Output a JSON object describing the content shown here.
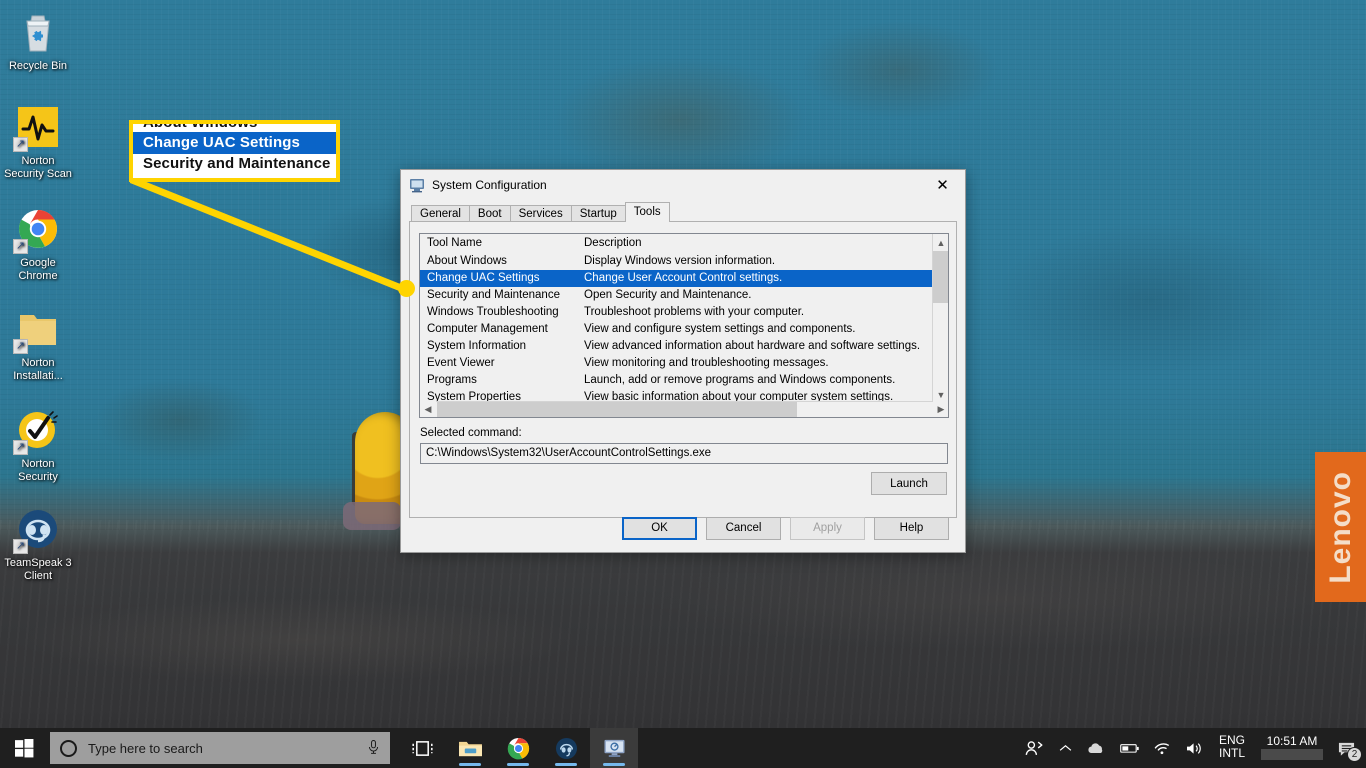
{
  "desktop": {
    "icons": [
      {
        "label": "Recycle Bin",
        "icon": "recycle-bin-icon",
        "shortcut": false
      },
      {
        "label": "Norton\nSecurity Scan",
        "label_l1": "Norton",
        "label_l2": "Security Scan",
        "icon": "norton-security-scan-icon",
        "shortcut": true
      },
      {
        "label": "Google Chrome",
        "label_l1": "Google",
        "label_l2": "Chrome",
        "icon": "google-chrome-icon",
        "shortcut": true
      },
      {
        "label": "Norton Installati...",
        "label_l1": "Norton",
        "label_l2": "Installati...",
        "icon": "folder-icon",
        "shortcut": true
      },
      {
        "label": "Norton Security",
        "label_l1": "Norton",
        "label_l2": "Security",
        "icon": "norton-security-icon",
        "shortcut": true
      },
      {
        "label": "TeamSpeak 3 Client",
        "label_l1": "TeamSpeak 3",
        "label_l2": "Client",
        "icon": "teamspeak-icon",
        "shortcut": true
      }
    ],
    "lenovo_sticker": "Lenovo",
    "colors": {
      "wall": "#2e7a99",
      "floor": "#37383a",
      "sticker": "#e2691c"
    }
  },
  "callout": {
    "rows": [
      {
        "text": "About Windows",
        "selected": false,
        "clipped": "top"
      },
      {
        "text": "Change UAC Settings",
        "selected": true,
        "clipped": "none"
      },
      {
        "text": "Security and Maintenance",
        "selected": false,
        "clipped": "bottom"
      }
    ],
    "border_color": "#ffd400",
    "highlight_color": "#0a64c8"
  },
  "window": {
    "title": "System Configuration",
    "title_icon": "system-configuration-icon",
    "close_label": "✕",
    "tabs": [
      {
        "label": "General",
        "active": false
      },
      {
        "label": "Boot",
        "active": false
      },
      {
        "label": "Services",
        "active": false
      },
      {
        "label": "Startup",
        "active": false
      },
      {
        "label": "Tools",
        "active": true
      }
    ],
    "list": {
      "columns": [
        "Tool Name",
        "Description"
      ],
      "rows": [
        {
          "name": "About Windows",
          "desc": "Display Windows version information.",
          "selected": false
        },
        {
          "name": "Change UAC Settings",
          "desc": "Change User Account Control settings.",
          "selected": true
        },
        {
          "name": "Security and Maintenance",
          "desc": "Open Security and Maintenance.",
          "selected": false
        },
        {
          "name": "Windows Troubleshooting",
          "desc": "Troubleshoot problems with your computer.",
          "selected": false
        },
        {
          "name": "Computer Management",
          "desc": "View and configure system settings and components.",
          "selected": false
        },
        {
          "name": "System Information",
          "desc": "View advanced information about hardware and software settings.",
          "selected": false
        },
        {
          "name": "Event Viewer",
          "desc": "View monitoring and troubleshooting messages.",
          "selected": false
        },
        {
          "name": "Programs",
          "desc": "Launch, add or remove programs and Windows components.",
          "selected": false
        },
        {
          "name": "System Properties",
          "desc": "View basic information about your computer system settings.",
          "selected": false
        }
      ]
    },
    "selected_command_label": "Selected command:",
    "selected_command_value": "C:\\Windows\\System32\\UserAccountControlSettings.exe",
    "launch_label": "Launch",
    "footer_buttons": [
      {
        "label": "OK",
        "state": "default"
      },
      {
        "label": "Cancel",
        "state": "normal"
      },
      {
        "label": "Apply",
        "state": "disabled"
      },
      {
        "label": "Help",
        "state": "normal"
      }
    ]
  },
  "taskbar": {
    "start_icon": "windows-start-icon",
    "search_placeholder": "Type here to search",
    "search_icon": "search-circle-icon",
    "mic_icon": "microphone-icon",
    "buttons": [
      {
        "name": "task-view-icon",
        "label": ""
      },
      {
        "name": "file-explorer-icon",
        "label": ""
      },
      {
        "name": "google-chrome-icon",
        "label": ""
      },
      {
        "name": "teamspeak-icon",
        "label": ""
      },
      {
        "name": "system-configuration-icon",
        "label": ""
      }
    ],
    "tray": {
      "people_icon": "people-icon",
      "chevron_icon": "chevron-up-icon",
      "onedrive_icon": "onedrive-cloud-icon",
      "battery_icon": "battery-icon",
      "wifi_icon": "wifi-icon",
      "volume_icon": "volume-icon",
      "language_line1": "ENG",
      "language_line2": "INTL",
      "time": "10:51 AM",
      "date": "",
      "notification_icon": "notification-icon",
      "notification_count": "2"
    }
  }
}
